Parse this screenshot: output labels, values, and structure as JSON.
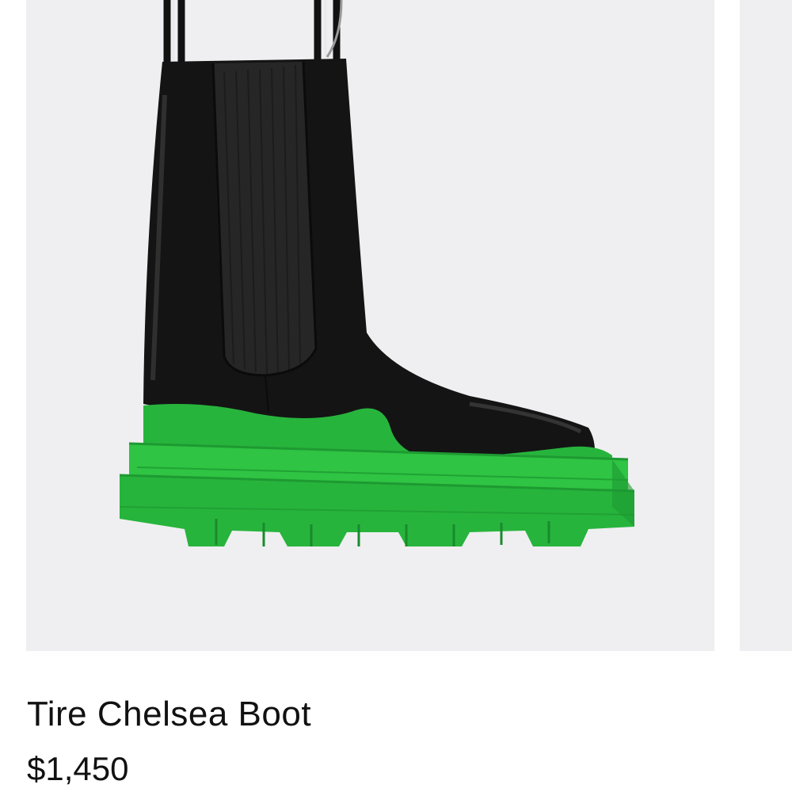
{
  "product": {
    "name": "Tire Chelsea Boot",
    "price": "$1,450",
    "image_subject": "boot-image",
    "colors": {
      "image_background": "#efeff1",
      "leather": "#141414",
      "elastic_panel": "#262626",
      "sole": "#27b43c",
      "sole_shadow": "#1e9a32",
      "text": "#111111"
    }
  },
  "next_card": {
    "image_background": "#efeff1"
  }
}
